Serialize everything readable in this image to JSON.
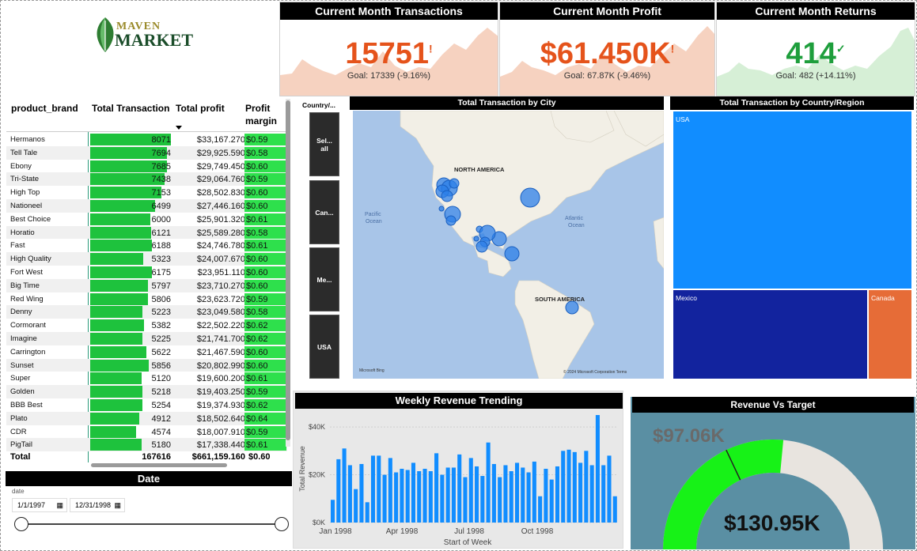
{
  "brand": {
    "top": "MAVEN",
    "bottom": "MARKET"
  },
  "kpis": [
    {
      "title": "Current Month Transactions",
      "value": "15751",
      "indicator": "!",
      "goal": "Goal: 17339 (-9.16%)",
      "color": "#e5531b"
    },
    {
      "title": "Current Month Profit",
      "value": "$61.450K",
      "indicator": "!",
      "goal": "Goal: 67.87K (-9.46%)",
      "color": "#e5531b"
    },
    {
      "title": "Current Month Returns",
      "value": "414",
      "indicator": "✓",
      "goal": "Goal: 482 (+14.11%)",
      "color": "#1e9e3c"
    }
  ],
  "table": {
    "headers": {
      "brand": "product_brand",
      "tx": "Total Transaction",
      "profit": "Total profit",
      "pm1": "Profit",
      "pm2": "margin"
    },
    "rows": [
      {
        "brand": "Hermanos",
        "tx": "8071",
        "tx_n": 8071,
        "profit": "$33,167.270",
        "pm": "$0.59"
      },
      {
        "brand": "Tell Tale",
        "tx": "7694",
        "tx_n": 7694,
        "profit": "$29,925.590",
        "pm": "$0.58"
      },
      {
        "brand": "Ebony",
        "tx": "7685",
        "tx_n": 7685,
        "profit": "$29,749.450",
        "pm": "$0.60"
      },
      {
        "brand": "Tri-State",
        "tx": "7438",
        "tx_n": 7438,
        "profit": "$29,064.760",
        "pm": "$0.59"
      },
      {
        "brand": "High Top",
        "tx": "7153",
        "tx_n": 7153,
        "profit": "$28,502.830",
        "pm": "$0.60"
      },
      {
        "brand": "Nationeel",
        "tx": "6499",
        "tx_n": 6499,
        "profit": "$27,446.160",
        "pm": "$0.60"
      },
      {
        "brand": "Best Choice",
        "tx": "6000",
        "tx_n": 6000,
        "profit": "$25,901.320",
        "pm": "$0.61"
      },
      {
        "brand": "Horatio",
        "tx": "6121",
        "tx_n": 6121,
        "profit": "$25,589.280",
        "pm": "$0.58"
      },
      {
        "brand": "Fast",
        "tx": "6188",
        "tx_n": 6188,
        "profit": "$24,746.780",
        "pm": "$0.61"
      },
      {
        "brand": "High Quality",
        "tx": "5323",
        "tx_n": 5323,
        "profit": "$24,007.670",
        "pm": "$0.60"
      },
      {
        "brand": "Fort West",
        "tx": "6175",
        "tx_n": 6175,
        "profit": "$23,951.110",
        "pm": "$0.60"
      },
      {
        "brand": "Big Time",
        "tx": "5797",
        "tx_n": 5797,
        "profit": "$23,710.270",
        "pm": "$0.60"
      },
      {
        "brand": "Red Wing",
        "tx": "5806",
        "tx_n": 5806,
        "profit": "$23,623.720",
        "pm": "$0.59"
      },
      {
        "brand": "Denny",
        "tx": "5223",
        "tx_n": 5223,
        "profit": "$23,049.580",
        "pm": "$0.58"
      },
      {
        "brand": "Cormorant",
        "tx": "5382",
        "tx_n": 5382,
        "profit": "$22,502.220",
        "pm": "$0.62"
      },
      {
        "brand": "Imagine",
        "tx": "5225",
        "tx_n": 5225,
        "profit": "$21,741.700",
        "pm": "$0.62"
      },
      {
        "brand": "Carrington",
        "tx": "5622",
        "tx_n": 5622,
        "profit": "$21,467.590",
        "pm": "$0.60"
      },
      {
        "brand": "Sunset",
        "tx": "5856",
        "tx_n": 5856,
        "profit": "$20,802.990",
        "pm": "$0.60"
      },
      {
        "brand": "Super",
        "tx": "5120",
        "tx_n": 5120,
        "profit": "$19,600.200",
        "pm": "$0.61"
      },
      {
        "brand": "Golden",
        "tx": "5218",
        "tx_n": 5218,
        "profit": "$19,403.250",
        "pm": "$0.59"
      },
      {
        "brand": "BBB Best",
        "tx": "5254",
        "tx_n": 5254,
        "profit": "$19,374.930",
        "pm": "$0.62"
      },
      {
        "brand": "Plato",
        "tx": "4912",
        "tx_n": 4912,
        "profit": "$18,502.640",
        "pm": "$0.64"
      },
      {
        "brand": "CDR",
        "tx": "4574",
        "tx_n": 4574,
        "profit": "$18,007.910",
        "pm": "$0.59"
      },
      {
        "brand": "PigTail",
        "tx": "5180",
        "tx_n": 5180,
        "profit": "$17,338.440",
        "pm": "$0.61"
      }
    ],
    "total": {
      "label": "Total",
      "tx": "167616",
      "profit": "$661,159.160",
      "pm": "$0.60"
    }
  },
  "date_slicer": {
    "title": "Date",
    "label": "date",
    "start": "1/1/1997",
    "end": "12/31/1998"
  },
  "country_slicer": {
    "title": "Country/...",
    "items": [
      "Sel... all",
      "Can...",
      "Me...",
      "USA"
    ]
  },
  "map": {
    "title": "Total Transaction by City",
    "labels": {
      "na": "NORTH AMERICA",
      "sa": "SOUTH AMERICA",
      "pacific1": "Pacific",
      "pacific2": "Ocean",
      "atlantic1": "Atlantic",
      "atlantic2": "Ocean"
    },
    "attribution": "© 2024 Microsoft Corporation   Terms",
    "bing": "Microsoft Bing"
  },
  "treemap": {
    "title": "Total Transaction by Country/Region",
    "usa": "USA",
    "mexico": "Mexico",
    "canada": "Canada",
    "colors": {
      "usa": "#118dff",
      "mexico": "#12239e",
      "canada": "#e66c37"
    }
  },
  "chart_data": {
    "type": "bar",
    "title": "Weekly Revenue Trending",
    "xlabel": "Start of Week",
    "ylabel": "Total Revenue",
    "ylim": [
      0,
      45000
    ],
    "yticks": [
      "$0K",
      "$20K",
      "$40K"
    ],
    "xticks": [
      "Jan 1998",
      "Apr 1998",
      "Jul 1998",
      "Oct 1998"
    ],
    "values": [
      9500,
      26500,
      31000,
      24000,
      14000,
      24500,
      8500,
      28000,
      28000,
      20000,
      27000,
      21000,
      22500,
      22000,
      25000,
      21500,
      22500,
      21500,
      29000,
      20000,
      23000,
      23000,
      28500,
      19000,
      27000,
      23500,
      19500,
      33500,
      24500,
      19000,
      24000,
      21500,
      25000,
      23000,
      21000,
      25500,
      11000,
      22500,
      18000,
      23500,
      30000,
      30500,
      29500,
      25000,
      30000,
      24000,
      45000,
      24000,
      28000,
      11000
    ]
  },
  "gauge": {
    "title": "Revenue Vs Target",
    "target_label": "$97.06K",
    "value_label": "$130.95K",
    "value": 97060,
    "max": 130950
  }
}
